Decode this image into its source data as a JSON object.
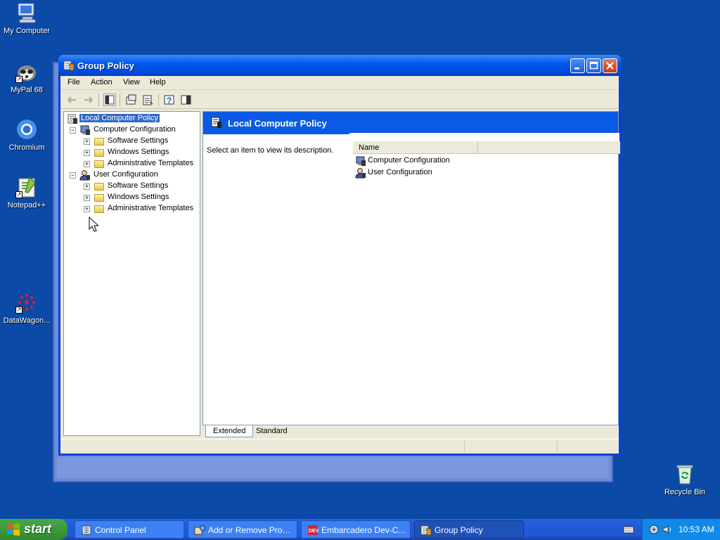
{
  "desktop": {
    "icons": [
      {
        "label": "My Computer"
      },
      {
        "label": "MyPal 68"
      },
      {
        "label": "Chromium"
      },
      {
        "label": "Notepad++"
      },
      {
        "label": "DataWagon..."
      },
      {
        "label": "Recycle Bin"
      }
    ]
  },
  "window": {
    "title": "Group Policy",
    "menu": [
      "File",
      "Action",
      "View",
      "Help"
    ],
    "tree": {
      "root": "Local Computer Policy",
      "computer_config": "Computer Configuration",
      "user_config": "User Configuration",
      "children": [
        "Software Settings",
        "Windows Settings",
        "Administrative Templates"
      ]
    },
    "right_pane": {
      "header": "Local Computer Policy",
      "description": "Select an item to view its description.",
      "column_name": "Name",
      "items": [
        "Computer Configuration",
        "User Configuration"
      ]
    },
    "tabs": [
      "Extended",
      "Standard"
    ]
  },
  "taskbar": {
    "start_label": "start",
    "tasks": [
      {
        "label": "Control Panel"
      },
      {
        "label": "Add or Remove Progr..."
      },
      {
        "label": "Embarcadero Dev-C+..."
      },
      {
        "label": "Group Policy"
      }
    ],
    "clock": "10:53 AM"
  },
  "colors": {
    "desktop_bg": "#0b4aa7",
    "titlebar": "#0058ee",
    "selection": "#316ac5",
    "pane_header": "#0b5ae5",
    "start_green": "#3c9a3c"
  }
}
